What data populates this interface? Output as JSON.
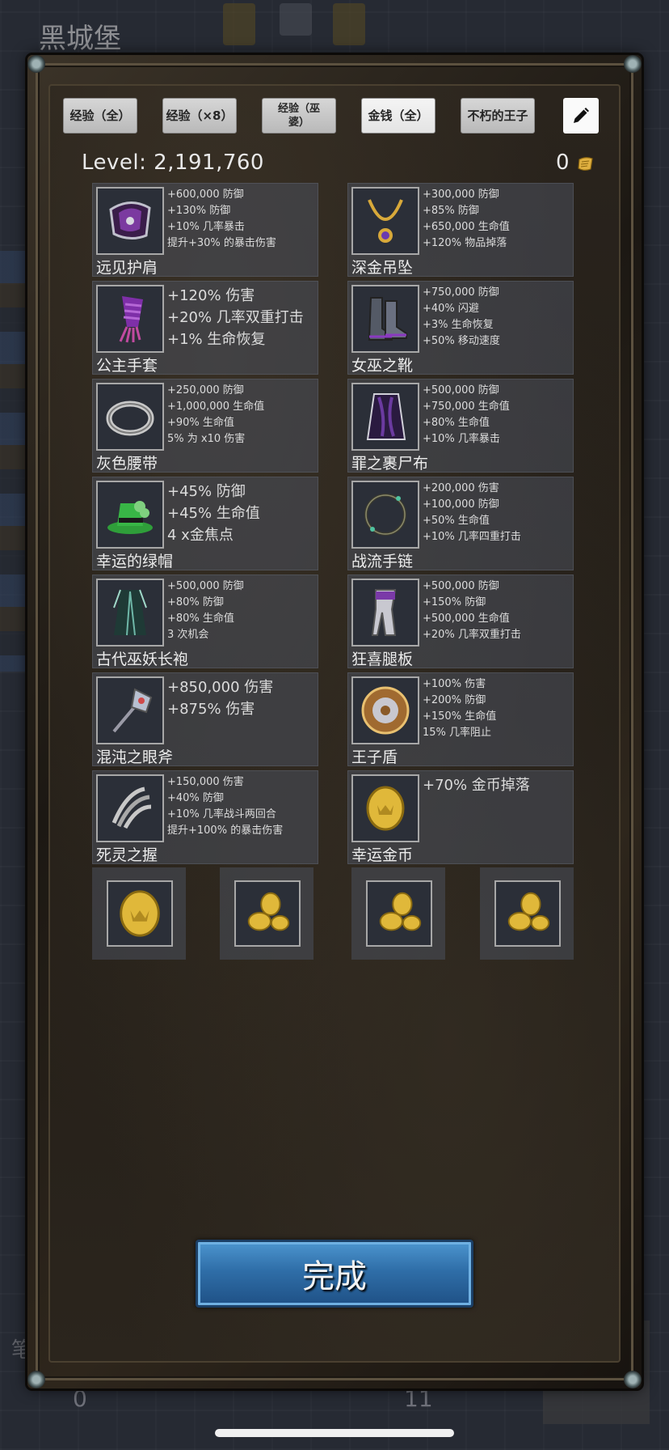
{
  "background": {
    "location_title": "黑城堡",
    "bottom_left_value": "0",
    "bottom_right_value": "11"
  },
  "toolbar": {
    "buttons": [
      {
        "label": "经验（全）"
      },
      {
        "label": "经验（×8）"
      },
      {
        "label": "经验（巫婆）"
      },
      {
        "label": "金钱（全）"
      },
      {
        "label": "不朽的王子"
      }
    ],
    "edit_icon": "pencil-icon"
  },
  "status": {
    "level_text": "Level: 2,191,760",
    "coin_count": "0"
  },
  "items": [
    {
      "name": "远见护肩",
      "icon": "pauldron-icon",
      "stats": [
        "+600,000 防御",
        "+130% 防御",
        "+10% 几率暴击",
        "提升+30% 的暴击伤害"
      ]
    },
    {
      "name": "深金吊坠",
      "icon": "pendant-icon",
      "stats": [
        "+300,000 防御",
        "+85% 防御",
        "+650,000 生命值",
        "+120% 物品掉落"
      ]
    },
    {
      "name": "公主手套",
      "icon": "gauntlet-icon",
      "stats": [
        "+120% 伤害",
        "+20% 几率双重打击",
        "+1% 生命恢复"
      ]
    },
    {
      "name": "女巫之靴",
      "icon": "boots-icon",
      "stats": [
        "+750,000 防御",
        "+40% 闪避",
        "+3% 生命恢复",
        "+50% 移动速度"
      ]
    },
    {
      "name": "灰色腰带",
      "icon": "belt-icon",
      "stats": [
        "+250,000 防御",
        "+1,000,000 生命值",
        "+90% 生命值",
        "5% 为 x10 伤害"
      ]
    },
    {
      "name": "罪之裹尸布",
      "icon": "shroud-icon",
      "stats": [
        "+500,000 防御",
        "+750,000 生命值",
        "+80% 生命值",
        "+10% 几率暴击"
      ]
    },
    {
      "name": "幸运的绿帽",
      "icon": "green-hat-icon",
      "stats": [
        "+45% 防御",
        "+45% 生命值",
        "4 x金焦点"
      ]
    },
    {
      "name": "战流手链",
      "icon": "bracelet-icon",
      "stats": [
        "+200,000 伤害",
        "+100,000 防御",
        "+50% 生命值",
        "+10% 几率四重打击"
      ]
    },
    {
      "name": "古代巫妖长袍",
      "icon": "robe-icon",
      "stats": [
        "+500,000 防御",
        "+80% 防御",
        "+80% 生命值",
        "3 次机会"
      ]
    },
    {
      "name": "狂喜腿板",
      "icon": "greaves-icon",
      "stats": [
        "+500,000 防御",
        "+150% 防御",
        "+500,000 生命值",
        "+20% 几率双重打击"
      ]
    },
    {
      "name": "混沌之眼斧",
      "icon": "axe-icon",
      "stats": [
        "+850,000 伤害",
        "+875% 伤害"
      ]
    },
    {
      "name": "王子盾",
      "icon": "shield-icon",
      "stats": [
        "+100% 伤害",
        "+200% 防御",
        "+150% 生命值",
        "15% 几率阻止"
      ]
    },
    {
      "name": "死灵之握",
      "icon": "bone-hand-icon",
      "stats": [
        "+150,000 伤害",
        "+40% 防御",
        "+10% 几率战斗两回合",
        "提升+100% 的暴击伤害"
      ]
    },
    {
      "name": "幸运金币",
      "icon": "gold-coin-icon",
      "stats": [
        "+70% 金币掉落"
      ]
    }
  ],
  "coin_tiles": [
    {
      "icon": "gold-coin-icon"
    },
    {
      "icon": "coin-pile-icon"
    },
    {
      "icon": "coin-pile-icon"
    },
    {
      "icon": "coin-pile-icon"
    }
  ],
  "done_label": "完成"
}
